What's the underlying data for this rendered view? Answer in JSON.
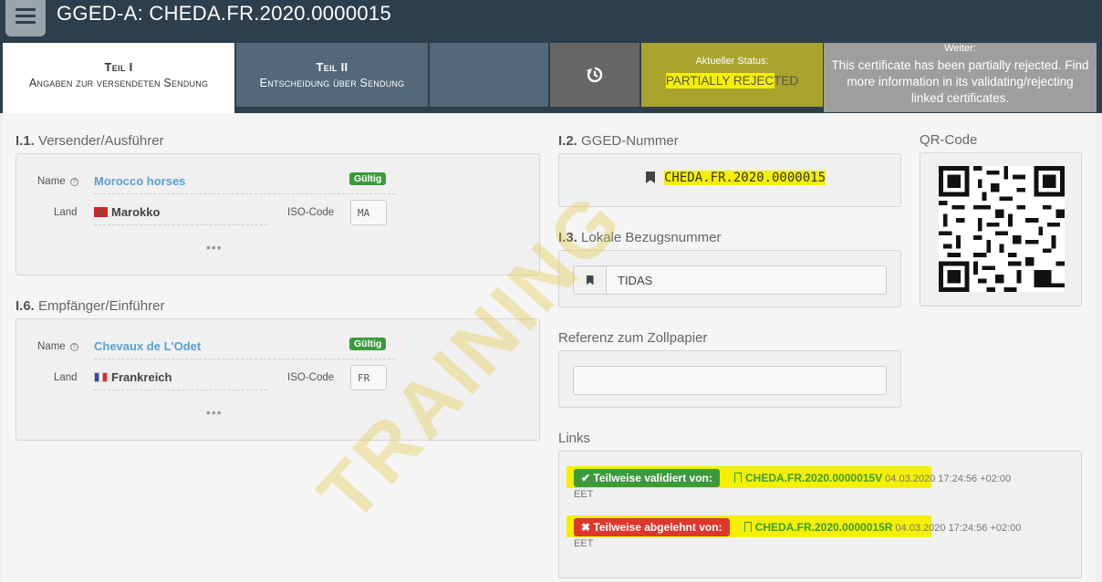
{
  "header": {
    "title": "GGED-A: CHEDA.FR.2020.0000015"
  },
  "tabs": {
    "teil1": {
      "title": "Teil I",
      "subtitle": "Angaben zur versendeten Sendung"
    },
    "teil2": {
      "title": "Teil II",
      "subtitle": "Entscheidung über Sendung"
    },
    "history_icon": "history-icon",
    "status": {
      "label": "Aktueller Status:",
      "value": "PARTIALLY REJECTED"
    },
    "next": {
      "label": "Weiter:",
      "text": "This certificate has been partially rejected. Find more information in its validating/rejecting linked certificates."
    }
  },
  "consignor": {
    "section_num": "I.1.",
    "section_title": "Versender/Ausführer",
    "name_label": "Name",
    "name_value": "Morocco horses",
    "valid_badge": "Gültig",
    "country_label": "Land",
    "country_value": "Marokko",
    "iso_label": "ISO-Code",
    "iso_value": "MA",
    "more": "•••"
  },
  "consignee": {
    "section_num": "I.6.",
    "section_title": "Empfänger/Einführer",
    "name_label": "Name",
    "name_value": "Chevaux de L'Odet",
    "valid_badge": "Gültig",
    "country_label": "Land",
    "country_value": "Frankreich",
    "iso_label": "ISO-Code",
    "iso_value": "FR",
    "more": "•••"
  },
  "gged_number": {
    "section_num": "I.2.",
    "section_title": "GGED-Nummer",
    "value": "CHEDA.FR.2020.0000015"
  },
  "local_ref": {
    "section_num": "I.3.",
    "section_title": "Lokale Bezugsnummer",
    "value": "TIDAS"
  },
  "customs_ref": {
    "section_title": "Referenz zum Zollpapier",
    "value": ""
  },
  "qr": {
    "section_title": "QR-Code"
  },
  "links": {
    "section_title": "Links",
    "items": [
      {
        "status": "Teilweise validiert von:",
        "id": "CHEDA.FR.2020.0000015V",
        "date": "04.03.2020 17:24:56 +02:00",
        "tz": "EET",
        "color": "#3c9a3c"
      },
      {
        "status": "Teilweise abgelehnt von:",
        "id": "CHEDA.FR.2020.0000015R",
        "date": "04.03.2020 17:24:56 +02:00",
        "tz": "EET",
        "color": "#e0372d"
      }
    ]
  },
  "watermark": "TRAINING"
}
